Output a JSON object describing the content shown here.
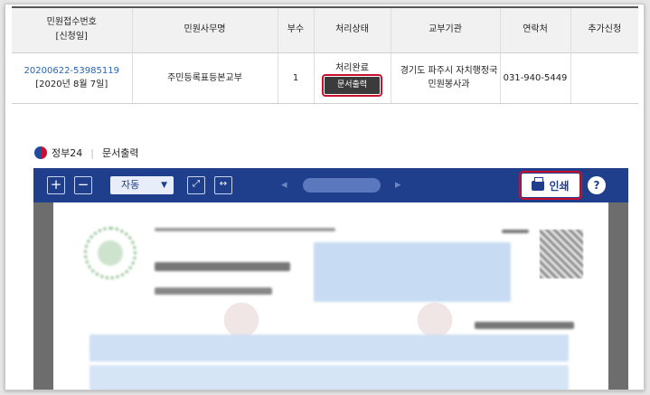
{
  "table": {
    "headers": [
      "민원접수번호\n[신청일]",
      "민원사무명",
      "부수",
      "처리상태",
      "교부기관",
      "연락처",
      "추가신청"
    ],
    "row": {
      "app_no": "20200622-53985119",
      "app_date": "[2020년 8월 7일]",
      "service": "주민등록표등본교부",
      "copies": "1",
      "status": "처리완료",
      "action": "문서출력",
      "agency_line1": "경기도 파주시 자치행정국",
      "agency_line2": "민원봉사과",
      "contact": "031-940-5449",
      "extra": ""
    }
  },
  "viewer": {
    "brand": "정부24",
    "title": "문서출력",
    "zoom": "자동",
    "print_label": "인쇄",
    "help": "?"
  },
  "colors": {
    "toolbar": "#1f3f8c",
    "highlight": "#c8102e",
    "link": "#2864b8"
  }
}
